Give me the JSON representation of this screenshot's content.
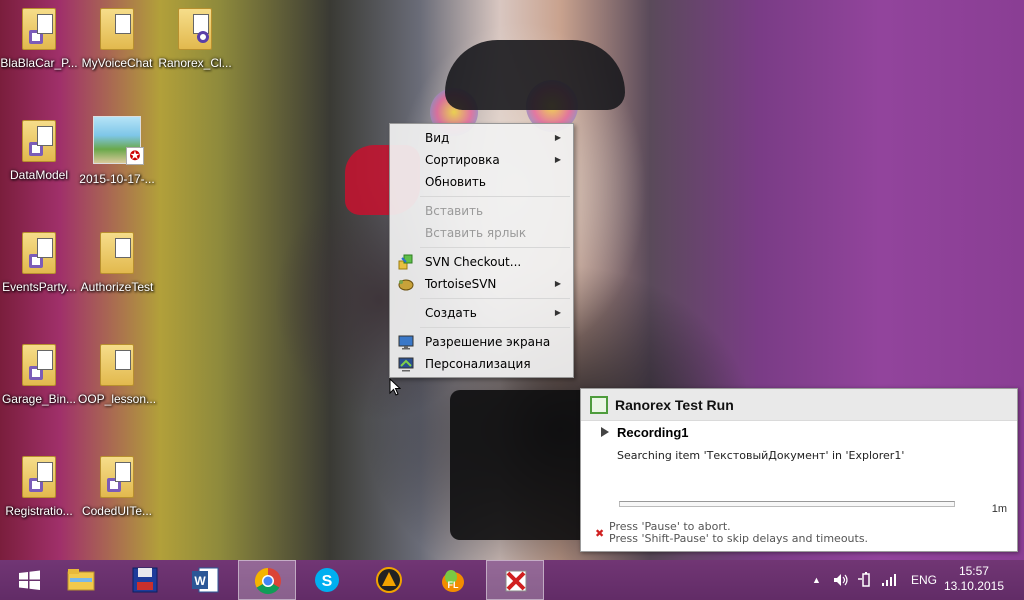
{
  "desktop": {
    "icons": [
      {
        "label": "BlaBlaCar_P...",
        "kind": "vs-folder"
      },
      {
        "label": "MyVoiceChat",
        "kind": "doc-folder"
      },
      {
        "label": "Ranorex_Cl...",
        "kind": "cd-folder"
      },
      {
        "label": "DataModel",
        "kind": "vs-folder"
      },
      {
        "label": "2015-10-17-...",
        "kind": "pdf"
      },
      {
        "label": "EventsParty...",
        "kind": "vs-folder"
      },
      {
        "label": "AuthorizeTest",
        "kind": "doc-folder"
      },
      {
        "label": "Garage_Bin...",
        "kind": "vs-folder"
      },
      {
        "label": "OOP_lesson...",
        "kind": "doc-folder"
      },
      {
        "label": "Registratio...",
        "kind": "vs-folder"
      },
      {
        "label": "CodedUITe...",
        "kind": "vs-folder"
      }
    ]
  },
  "context_menu": {
    "items": [
      {
        "label": "Вид",
        "submenu": true,
        "disabled": false
      },
      {
        "label": "Сортировка",
        "submenu": true,
        "disabled": false
      },
      {
        "label": "Обновить",
        "submenu": false,
        "disabled": false
      },
      {
        "label": "Вставить",
        "submenu": false,
        "disabled": true
      },
      {
        "label": "Вставить ярлык",
        "submenu": false,
        "disabled": true
      },
      {
        "label": "SVN Checkout...",
        "submenu": false,
        "disabled": false,
        "icon": "svn-checkout-icon"
      },
      {
        "label": "TortoiseSVN",
        "submenu": true,
        "disabled": false,
        "icon": "tortoise-icon"
      },
      {
        "label": "Создать",
        "submenu": true,
        "disabled": false
      },
      {
        "label": "Разрешение экрана",
        "submenu": false,
        "disabled": false,
        "icon": "screen-resolution-icon"
      },
      {
        "label": "Персонализация",
        "submenu": false,
        "disabled": false,
        "icon": "personalization-icon"
      }
    ]
  },
  "ranorex": {
    "title": "Ranorex Test Run",
    "recording": "Recording1",
    "status": "Searching item 'ТекстовыйДокумент' in 'Explorer1'",
    "progress": 0,
    "time": "1m",
    "hint_pause": "Press 'Pause' to abort.",
    "hint_shift": "Press 'Shift-Pause' to skip delays and timeouts."
  },
  "taskbar": {
    "apps": [
      {
        "name": "file-explorer-icon"
      },
      {
        "name": "save-floppy-icon"
      },
      {
        "name": "word-icon"
      },
      {
        "name": "chrome-icon",
        "active": true
      },
      {
        "name": "skype-icon"
      },
      {
        "name": "aimp-icon"
      },
      {
        "name": "fl-studio-icon"
      },
      {
        "name": "ranorex-icon",
        "active": true
      }
    ],
    "language": "ENG",
    "time": "15:57",
    "date": "13.10.2015"
  },
  "colors": {
    "menu_bg": "#f1f1f1",
    "taskbar_bg": "#6e3674",
    "progress": "#49a845"
  }
}
